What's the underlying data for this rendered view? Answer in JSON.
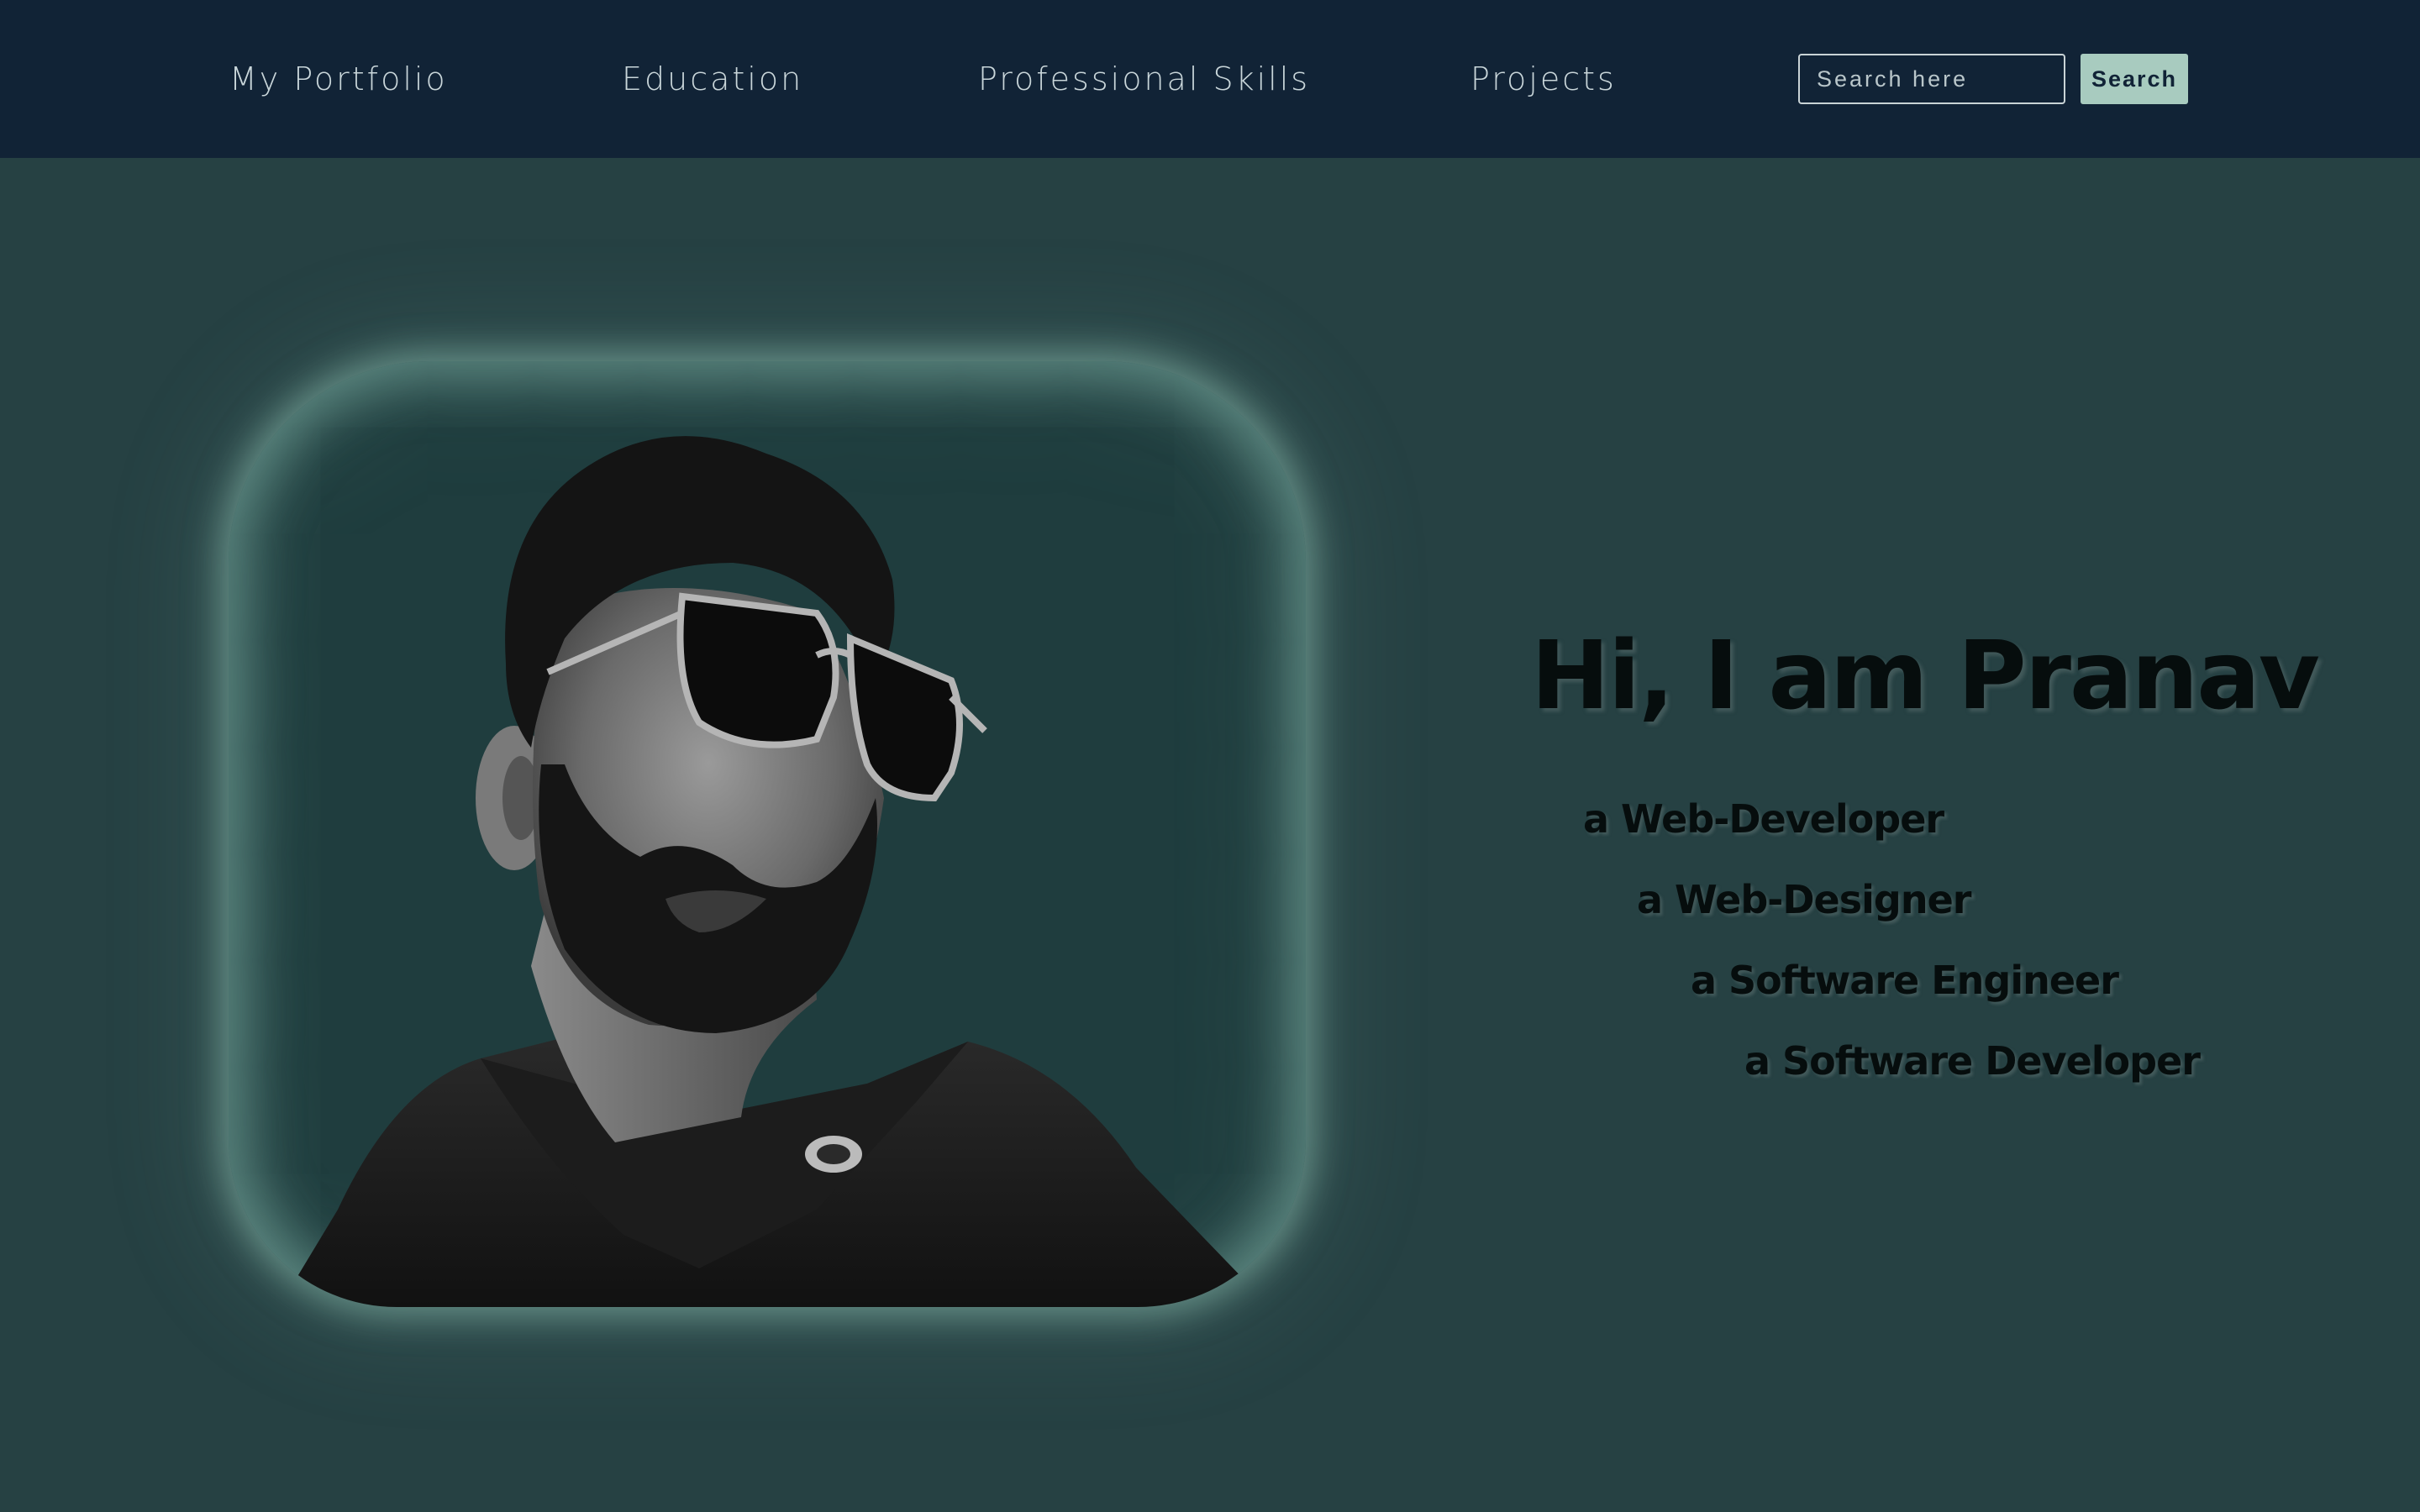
{
  "navbar": {
    "links": [
      {
        "label": "My Portfolio"
      },
      {
        "label": "Education"
      },
      {
        "label": "Professional Skills"
      },
      {
        "label": "Projects"
      }
    ],
    "search": {
      "placeholder": "Search here",
      "value": "",
      "button_label": "Search"
    }
  },
  "hero": {
    "title": "Hi, I am Pranav",
    "roles": [
      "a Web-Developer",
      "a Web-Designer",
      "a Software Engineer",
      "a Software Developer"
    ],
    "portrait": {
      "alt": "Pranav portrait photo"
    }
  },
  "colors": {
    "navbar_bg": "#112336",
    "page_bg": "#264143",
    "accent": "#a8cbbf",
    "frame_glow": "#8cbeaf",
    "heading_text": "#060d0d",
    "nav_text": "#c9d6da"
  }
}
